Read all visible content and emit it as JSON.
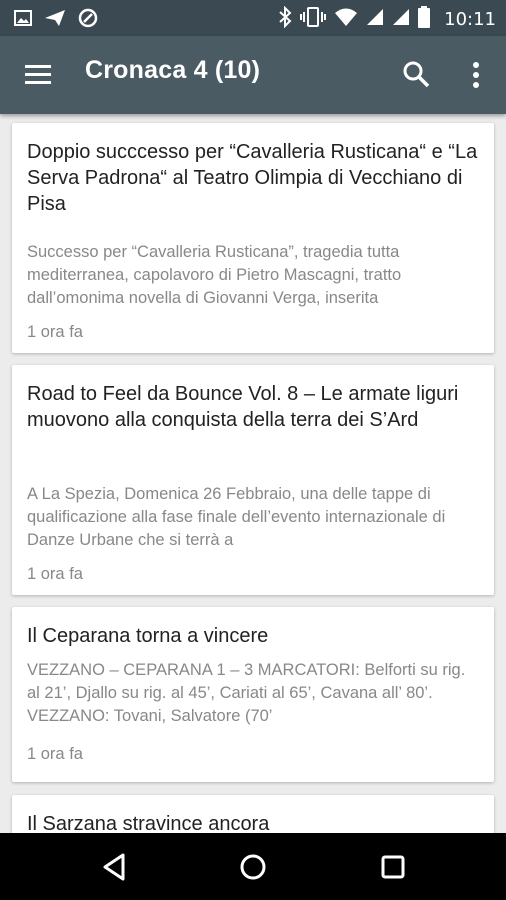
{
  "status_bar": {
    "time": "10:11",
    "icons_left": [
      "image-icon",
      "send-icon",
      "data-saver-icon"
    ],
    "icons_right": [
      "bluetooth-icon",
      "vibrate-icon",
      "wifi-icon",
      "signal-icon",
      "signal-icon",
      "battery-icon"
    ]
  },
  "toolbar": {
    "title": "Cronaca 4 (10)",
    "icons": [
      "menu-icon",
      "search-icon",
      "more-vert-icon"
    ]
  },
  "articles": [
    {
      "title": "Doppio succcesso per “Cavalleria Rusticana“ e “La Serva Padrona“ al Teatro Olimpia di Vecchiano di Pisa",
      "excerpt": "Successo per “Cavalleria Rusticana”, tragedia tutta mediterranea, capolavoro di Pietro Mascagni, tratto dall’omonima novella di Giovanni Verga, inserita",
      "time": "1 ora fa"
    },
    {
      "title": "Road to Feel da Bounce Vol. 8 – Le armate liguri muovono alla conquista della terra dei S’Ard",
      "excerpt": "A La Spezia, Domenica 26 Febbraio, una delle tappe di qualificazione alla fase finale dell’evento internazionale di Danze Urbane che si terrà a",
      "time": "1 ora fa"
    },
    {
      "title": "Il Ceparana torna a vincere",
      "excerpt": "VEZZANO – CEPARANA 1 – 3 MARCATORI: Belforti su rig. al 21’, Djallo su rig. al 45’, Cariati al 65’, Cavana all’ 80’. VEZZANO: Tovani, Salvatore (70’",
      "time": "1 ora fa"
    },
    {
      "title": "Il Sarzana stravince ancora"
    }
  ],
  "colors": {
    "status_bar": "#3b4a52",
    "toolbar": "#4a5b64",
    "background": "#ececec"
  }
}
